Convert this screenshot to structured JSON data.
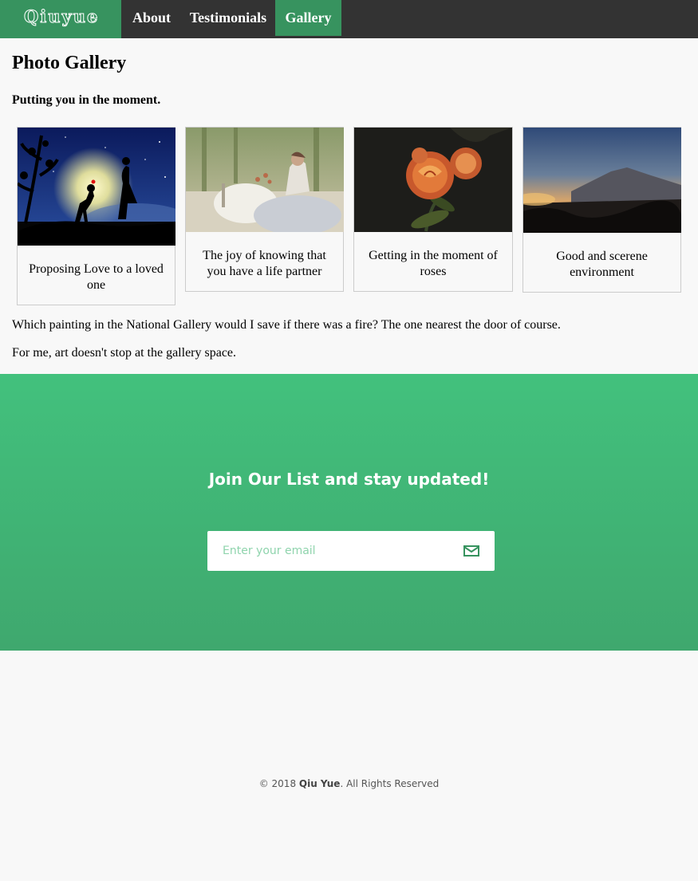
{
  "nav": {
    "logo": "Qiuyue",
    "items": [
      {
        "label": "About"
      },
      {
        "label": "Testimonials"
      },
      {
        "label": "Gallery"
      }
    ]
  },
  "main": {
    "title": "Photo Gallery",
    "subtitle": "Putting you in the moment.",
    "cards": [
      {
        "caption": "Proposing Love to a loved one",
        "image": "proposal-silhouette-night"
      },
      {
        "caption": "The joy of knowing that you have a life partner",
        "image": "bride-forest-table"
      },
      {
        "caption": "Getting in the moment of roses",
        "image": "orange-roses-dark"
      },
      {
        "caption": "Good and scerene environment",
        "image": "mountain-sunset"
      }
    ],
    "paragraphs": [
      "Which painting in the National Gallery would I save if there was a fire? The one nearest the door of course.",
      "For me, art doesn't stop at the gallery space."
    ]
  },
  "newsletter": {
    "title": "Join Our List and stay updated!",
    "email_placeholder": "Enter your email",
    "send_icon": "mail-icon"
  },
  "footer": {
    "prefix": "© 2018 ",
    "brand": "Qiu Yue",
    "suffix": ". All Rights Reserved"
  },
  "colors": {
    "nav_bg": "#333333",
    "accent": "#37935f",
    "newsletter_top": "#42c17d",
    "newsletter_bottom": "#3fa86e",
    "page_bg": "#f8f8f8"
  }
}
